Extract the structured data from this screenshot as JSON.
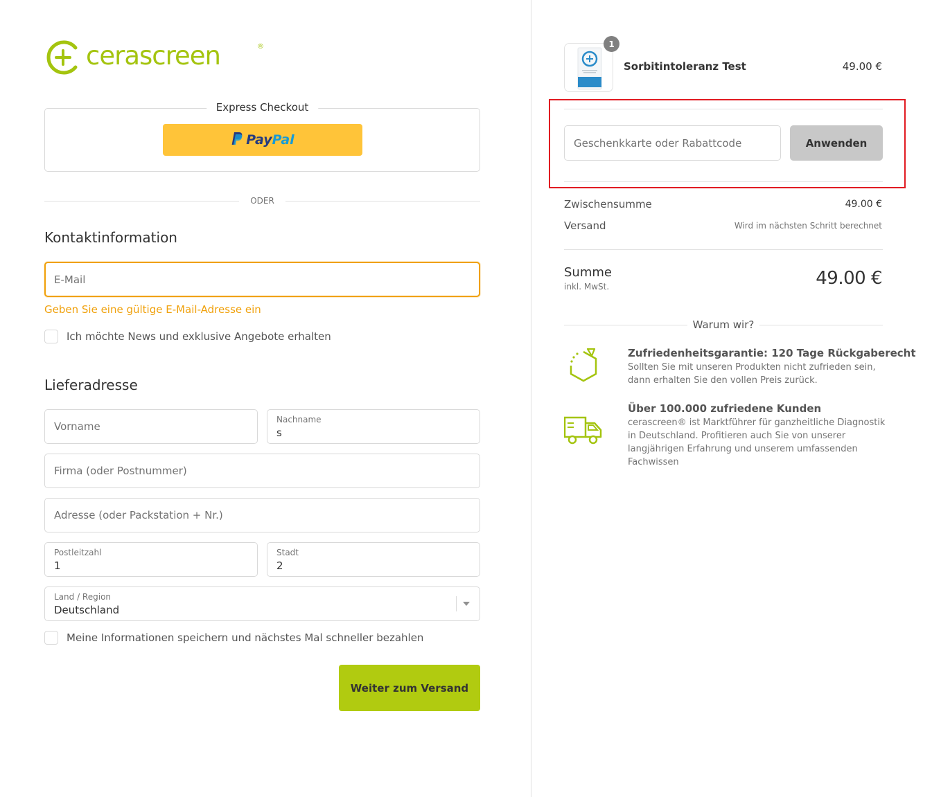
{
  "brand": {
    "name": "cerascreen",
    "reg": "®",
    "accent": "#a4c40f"
  },
  "express": {
    "title": "Express Checkout",
    "paypal_word1": "Pay",
    "paypal_word2": "Pal"
  },
  "divider_text": "ODER",
  "contact": {
    "title": "Kontaktinformation",
    "email_placeholder": "E-Mail",
    "email_error": "Geben Sie eine gültige E-Mail-Adresse ein",
    "newsletter_label": "Ich möchte News und exklusive Angebote erhalten"
  },
  "shipping": {
    "title": "Lieferadresse",
    "first_name_placeholder": "Vorname",
    "last_name_label": "Nachname",
    "last_name_value": "s",
    "company_placeholder": "Firma (oder Postnummer)",
    "address_placeholder": "Adresse (oder Packstation + Nr.)",
    "zip_label": "Postleitzahl",
    "zip_value": "1",
    "city_label": "Stadt",
    "city_value": "2",
    "country_label": "Land / Region",
    "country_value": "Deutschland",
    "save_info_label": "Meine Informationen speichern und nächstes Mal schneller bezahlen",
    "continue_label": "Weiter zum Versand"
  },
  "summary": {
    "product": {
      "name": "Sorbitintoleranz Test",
      "price": "49.00 €",
      "quantity": "1"
    },
    "discount_placeholder": "Geschenkkarte oder Rabattcode",
    "apply_label": "Anwenden",
    "subtotal_label": "Zwischensumme",
    "subtotal_value": "49.00 €",
    "shipping_label": "Versand",
    "shipping_value": "Wird im nächsten Schritt berechnet",
    "total_label": "Summe",
    "total_sub": "inkl. MwSt.",
    "total_value": "49.00 €"
  },
  "why": {
    "title": "Warum wir?",
    "benefits": [
      {
        "icon": "hexagon-arrow-icon",
        "title": "Zufriedenheitsgarantie: 120 Tage Rückgaberecht",
        "text": "Sollten Sie mit unseren Produkten nicht zufrieden sein, dann erhalten Sie den vollen Preis zurück."
      },
      {
        "icon": "delivery-truck-icon",
        "title": "Über 100.000 zufriedene Kunden",
        "text": "cerascreen® ist Marktführer für ganzheitliche Diagnostik in Deutschland. Profitieren auch Sie von unserer langjährigen Erfahrung und unserem umfassenden Fachwissen"
      }
    ]
  },
  "colors": {
    "accent_green": "#b1cb10",
    "error_orange": "#f0a10c",
    "paypal_yellow": "#ffc439",
    "highlight_red": "#e11b22"
  }
}
